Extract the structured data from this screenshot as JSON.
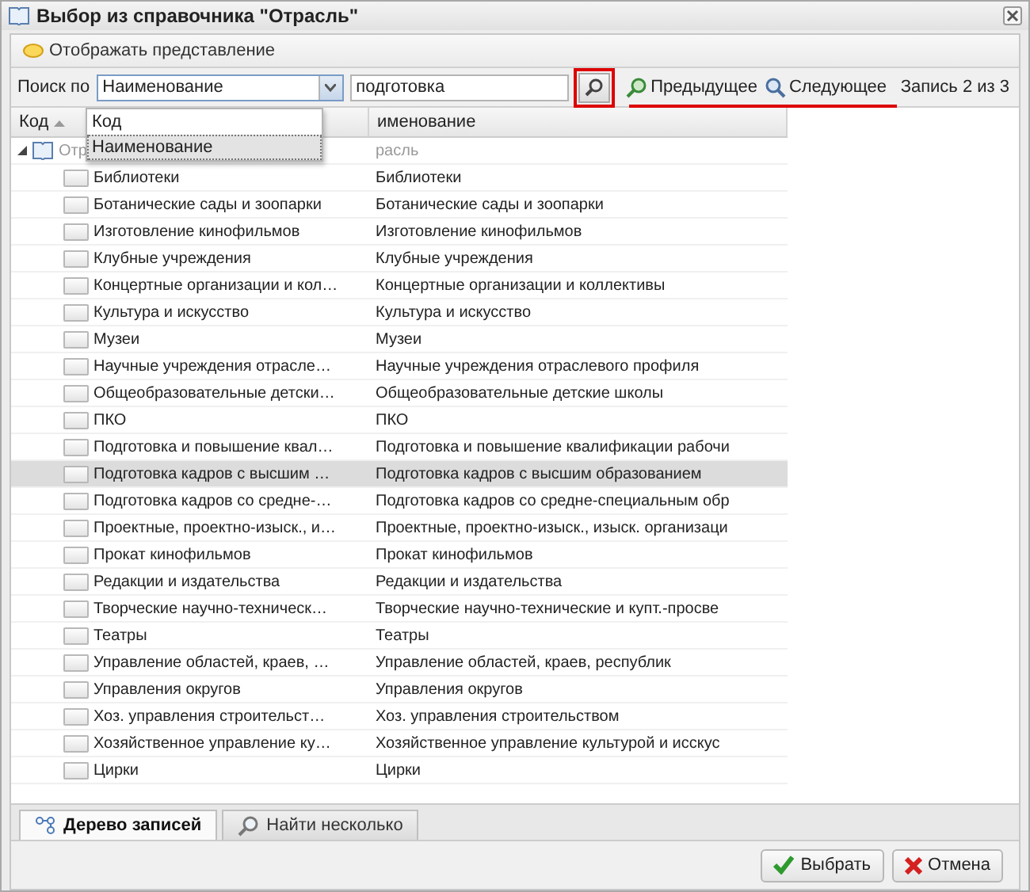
{
  "window": {
    "title": "Выбор из справочника \"Отрасль\""
  },
  "toolbar": {
    "view_button": "Отображать представление"
  },
  "search": {
    "label": "Поиск по",
    "field_select": {
      "value": "Наименование",
      "expanded": true,
      "options": [
        {
          "label": "Код",
          "selected": false
        },
        {
          "label": "Наименование",
          "selected": true
        }
      ]
    },
    "query": "подготовка",
    "previous": "Предыдущее",
    "next": "Следующее",
    "record": "Запись 2 из 3"
  },
  "table": {
    "columns": [
      "Код",
      "именование"
    ],
    "tree": [
      {
        "code": "Отр",
        "name": "расль",
        "expanded": true,
        "selected": false,
        "children": [
          {
            "code": "Библиотеки",
            "name": "Библиотеки",
            "selected": false
          },
          {
            "code": "Ботанические сады и зоопарки",
            "name": "Ботанические сады и зоопарки",
            "selected": false
          },
          {
            "code": "Изготовление кинофильмов",
            "name": "Изготовление кинофильмов",
            "selected": false
          },
          {
            "code": "Клубные учреждения",
            "name": "Клубные учреждения",
            "selected": false
          },
          {
            "code": "Концертные организации и кол…",
            "name": "Концертные организации и коллективы",
            "selected": false
          },
          {
            "code": "Культура и искусство",
            "name": "Культура и искусство",
            "selected": false
          },
          {
            "code": "Музеи",
            "name": "Музеи",
            "selected": false
          },
          {
            "code": "Научные учреждения отрасле…",
            "name": "Научные учреждения отраслевого профиля",
            "selected": false
          },
          {
            "code": "Общеобразовательные детски…",
            "name": "Общеобразовательные детские школы",
            "selected": false
          },
          {
            "code": "ПКО",
            "name": "ПКО",
            "selected": false
          },
          {
            "code": "Подготовка и повышение квал…",
            "name": "Подготовка и повышение квалификации рабочи",
            "selected": false
          },
          {
            "code": "Подготовка кадров с высшим …",
            "name": "Подготовка кадров с высшим образованием",
            "selected": true
          },
          {
            "code": "Подготовка кадров со средне-…",
            "name": "Подготовка кадров со средне-специальным обр",
            "selected": false
          },
          {
            "code": "Проектные, проектно-изыск., и…",
            "name": "Проектные, проектно-изыск., изыск. организаци",
            "selected": false
          },
          {
            "code": "Прокат кинофильмов",
            "name": "Прокат кинофильмов",
            "selected": false
          },
          {
            "code": "Редакции и издательства",
            "name": "Редакции и издательства",
            "selected": false
          },
          {
            "code": "Творческие научно-техническ…",
            "name": "Творческие научно-технические и купт.-просве",
            "selected": false
          },
          {
            "code": "Театры",
            "name": "Театры",
            "selected": false
          },
          {
            "code": "Управление областей, краев, …",
            "name": "Управление областей, краев, республик",
            "selected": false
          },
          {
            "code": "Управления округов",
            "name": "Управления округов",
            "selected": false
          },
          {
            "code": "Хоз. управления строительст…",
            "name": "Хоз. управления строительством",
            "selected": false
          },
          {
            "code": "Хозяйственное управление ку…",
            "name": "Хозяйственное управление культурой и исскус",
            "selected": false
          },
          {
            "code": "Цирки",
            "name": "Цирки",
            "selected": false
          }
        ]
      }
    ]
  },
  "tabs": [
    {
      "label": "Дерево записей",
      "selected": true
    },
    {
      "label": "Найти несколько",
      "selected": false
    }
  ],
  "buttons": [
    {
      "kind": "ok",
      "label": "Выбрать"
    },
    {
      "kind": "cancel",
      "label": "Отмена"
    }
  ]
}
